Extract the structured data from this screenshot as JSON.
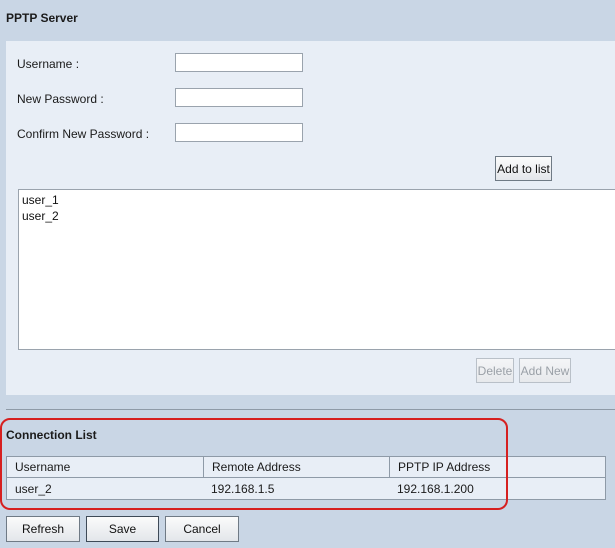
{
  "pptp_server": {
    "title": "PPTP Server",
    "username_label": "Username :",
    "username_value": "",
    "new_password_label": "New Password :",
    "new_password_value": "",
    "confirm_password_label": "Confirm New Password :",
    "confirm_password_value": "",
    "add_to_list_label": "Add to list",
    "users": [
      "user_1",
      "user_2"
    ],
    "delete_label": "Delete",
    "add_new_label": "Add New"
  },
  "connection_list": {
    "title": "Connection List",
    "columns": [
      "Username",
      "Remote Address",
      "PPTP IP Address"
    ],
    "rows": [
      {
        "username": "user_2",
        "remote_address": "192.168.1.5",
        "pptp_ip": "192.168.1.200"
      }
    ]
  },
  "footer": {
    "refresh_label": "Refresh",
    "save_label": "Save",
    "cancel_label": "Cancel"
  },
  "colors": {
    "background": "#c9d6e5",
    "panel": "#e8eef6",
    "highlight": "#d62020"
  }
}
